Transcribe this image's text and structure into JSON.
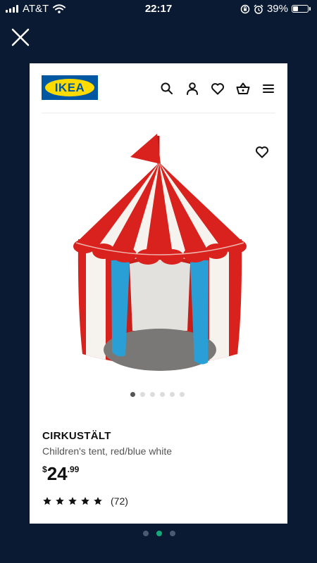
{
  "status_bar": {
    "carrier": "AT&T",
    "time": "22:17",
    "battery_percent": "39%",
    "battery_level": 0.39,
    "icons": [
      "signal-icon",
      "wifi-icon",
      "orientation-lock-icon",
      "alarm-icon",
      "battery-icon"
    ]
  },
  "overlay": {
    "close_icon": "close-icon"
  },
  "header": {
    "logo_text": "IKEA",
    "icons": [
      "search-icon",
      "profile-icon",
      "heart-icon",
      "basket-icon",
      "menu-icon"
    ]
  },
  "product": {
    "name": "CIRKUSTÄLT",
    "description": "Children's tent, red/blue white",
    "price": {
      "currency": "$",
      "whole": "24",
      "cents": ".99"
    },
    "rating": {
      "stars": 5,
      "count": "(72)"
    },
    "image_icon": "circus-tent-image",
    "carousel": {
      "total": 6,
      "active": 0
    }
  },
  "pager": {
    "total": 3,
    "active": 1
  },
  "colors": {
    "background": "#0a1a33",
    "ikea_blue": "#0058a3",
    "ikea_yellow": "#ffdb00",
    "tent_red": "#d9211d",
    "tent_blue": "#2a9fd6",
    "pager_active": "#17a87b"
  }
}
